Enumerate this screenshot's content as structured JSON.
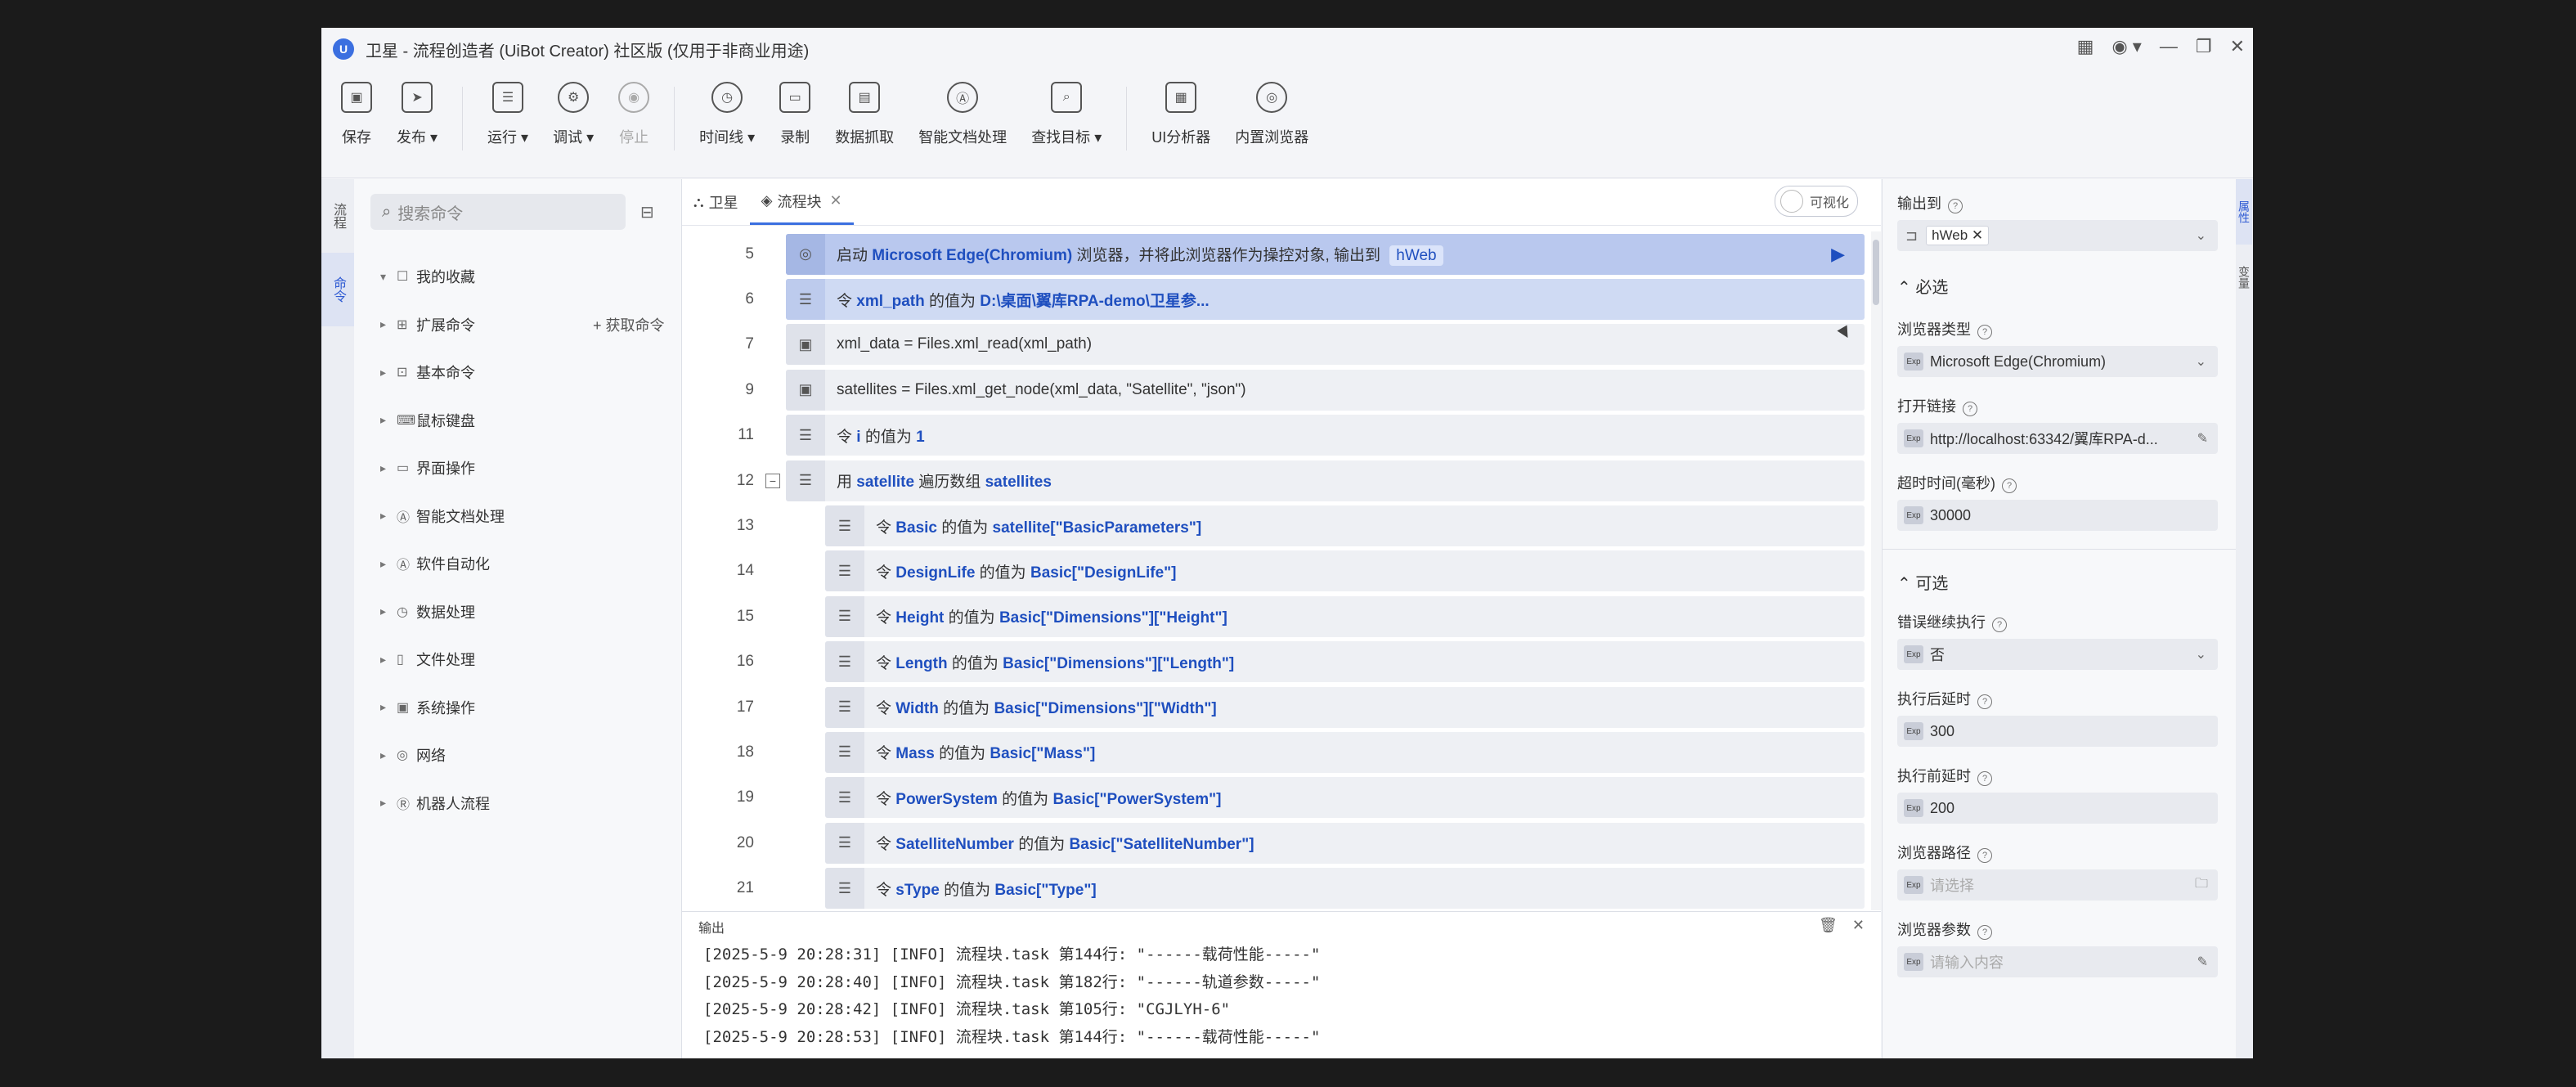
{
  "window": {
    "title": "卫星 - 流程创造者 (UiBot Creator) 社区版 (仅用于非商业用途)"
  },
  "toolbar": {
    "items": [
      {
        "label": "保存",
        "icon": "save-icon"
      },
      {
        "label": "发布 ▾",
        "icon": "send-icon"
      },
      {
        "label": "运行 ▾",
        "icon": "run-icon"
      },
      {
        "label": "调试 ▾",
        "icon": "debug-icon"
      },
      {
        "label": "停止",
        "icon": "stop-icon"
      },
      {
        "label": "时间线 ▾",
        "icon": "clock-icon"
      },
      {
        "label": "录制",
        "icon": "record-icon"
      },
      {
        "label": "数据抓取",
        "icon": "data-scrape-icon"
      },
      {
        "label": "智能文档处理",
        "icon": "ai-doc-icon"
      },
      {
        "label": "查找目标 ▾",
        "icon": "find-target-icon"
      },
      {
        "label": "UI分析器",
        "icon": "ui-analyzer-icon"
      },
      {
        "label": "内置浏览器",
        "icon": "builtin-browser-icon"
      }
    ]
  },
  "left_rail": {
    "tabs": [
      "流程",
      "命令"
    ]
  },
  "commands": {
    "search_placeholder": "搜索命令",
    "tree": [
      {
        "label": "我的收藏"
      },
      {
        "label": "扩展命令",
        "extra": "获取命令"
      },
      {
        "label": "基本命令"
      },
      {
        "label": "鼠标键盘"
      },
      {
        "label": "界面操作"
      },
      {
        "label": "智能文档处理"
      },
      {
        "label": "软件自动化"
      },
      {
        "label": "数据处理"
      },
      {
        "label": "文件处理"
      },
      {
        "label": "系统操作"
      },
      {
        "label": "网络"
      },
      {
        "label": "机器人流程"
      }
    ]
  },
  "editor": {
    "tabs": [
      {
        "label": "卫星",
        "active": false
      },
      {
        "label": "流程块",
        "active": true
      }
    ],
    "visualize_label": "可视化",
    "lines": [
      {
        "ln": "5",
        "indent": 0,
        "hl": "strong",
        "parts": [
          [
            "启动 ",
            ""
          ],
          [
            "Microsoft Edge(Chromium)",
            "kw"
          ],
          [
            " 浏览器，并将此浏览器作为操控对象, 输出到 ",
            ""
          ],
          [
            "hWeb",
            "tag"
          ]
        ],
        "play": true
      },
      {
        "ln": "6",
        "indent": 0,
        "hl": "light",
        "parts": [
          [
            "令 ",
            ""
          ],
          [
            "xml_path",
            "kw"
          ],
          [
            " 的值为 ",
            ""
          ],
          [
            "D:\\桌面\\翼库RPA-demo\\卫星参...",
            "kw"
          ]
        ]
      },
      {
        "ln": "7",
        "indent": 0,
        "parts": [
          [
            "xml_data = Files.xml_read(xml_path)",
            ""
          ]
        ]
      },
      {
        "ln": "9",
        "indent": 0,
        "parts": [
          [
            "satellites = Files.xml_get_node(xml_data, \"Satellite\", \"json\")",
            ""
          ]
        ]
      },
      {
        "ln": "11",
        "indent": 0,
        "parts": [
          [
            "令 ",
            ""
          ],
          [
            "i",
            "kw"
          ],
          [
            " 的值为 ",
            ""
          ],
          [
            "1",
            "kw"
          ]
        ]
      },
      {
        "ln": "12",
        "indent": 0,
        "fold": true,
        "parts": [
          [
            "用 ",
            ""
          ],
          [
            "satellite",
            "kw"
          ],
          [
            " 遍历数组 ",
            ""
          ],
          [
            "satellites",
            "kw"
          ]
        ]
      },
      {
        "ln": "13",
        "indent": 1,
        "parts": [
          [
            "令 ",
            ""
          ],
          [
            "Basic",
            "kw"
          ],
          [
            " 的值为 ",
            ""
          ],
          [
            "satellite[\"BasicParameters\"]",
            "kw"
          ]
        ]
      },
      {
        "ln": "14",
        "indent": 1,
        "parts": [
          [
            "令 ",
            ""
          ],
          [
            "DesignLife",
            "kw"
          ],
          [
            " 的值为 ",
            ""
          ],
          [
            "Basic[\"DesignLife\"]",
            "kw"
          ]
        ]
      },
      {
        "ln": "15",
        "indent": 1,
        "parts": [
          [
            "令 ",
            ""
          ],
          [
            "Height",
            "kw"
          ],
          [
            " 的值为 ",
            ""
          ],
          [
            "Basic[\"Dimensions\"][\"Height\"]",
            "kw"
          ]
        ]
      },
      {
        "ln": "16",
        "indent": 1,
        "parts": [
          [
            "令 ",
            ""
          ],
          [
            "Length",
            "kw"
          ],
          [
            " 的值为 ",
            ""
          ],
          [
            "Basic[\"Dimensions\"][\"Length\"]",
            "kw"
          ]
        ]
      },
      {
        "ln": "17",
        "indent": 1,
        "parts": [
          [
            "令 ",
            ""
          ],
          [
            "Width",
            "kw"
          ],
          [
            " 的值为 ",
            ""
          ],
          [
            "Basic[\"Dimensions\"][\"Width\"]",
            "kw"
          ]
        ]
      },
      {
        "ln": "18",
        "indent": 1,
        "parts": [
          [
            "令 ",
            ""
          ],
          [
            "Mass",
            "kw"
          ],
          [
            " 的值为 ",
            ""
          ],
          [
            "Basic[\"Mass\"]",
            "kw"
          ]
        ]
      },
      {
        "ln": "19",
        "indent": 1,
        "parts": [
          [
            "令 ",
            ""
          ],
          [
            "PowerSystem",
            "kw"
          ],
          [
            " 的值为 ",
            ""
          ],
          [
            "Basic[\"PowerSystem\"]",
            "kw"
          ]
        ]
      },
      {
        "ln": "20",
        "indent": 1,
        "parts": [
          [
            "令 ",
            ""
          ],
          [
            "SatelliteNumber",
            "kw"
          ],
          [
            " 的值为 ",
            ""
          ],
          [
            "Basic[\"SatelliteNumber\"]",
            "kw"
          ]
        ]
      },
      {
        "ln": "21",
        "indent": 1,
        "parts": [
          [
            "令 ",
            ""
          ],
          [
            "sType",
            "kw"
          ],
          [
            " 的值为 ",
            ""
          ],
          [
            "Basic[\"Type\"]",
            "kw"
          ]
        ]
      }
    ]
  },
  "output": {
    "title": "输出",
    "logs": [
      "[2025-5-9 20:28:31] [INFO] 流程块.task 第144行: \"------载荷性能-----\"",
      "[2025-5-9 20:28:40] [INFO] 流程块.task 第182行: \"------轨道参数-----\"",
      "[2025-5-9 20:28:42] [INFO] 流程块.task 第105行: \"CGJLYH-6\"",
      "[2025-5-9 20:28:53] [INFO] 流程块.task 第144行: \"------载荷性能-----\""
    ]
  },
  "properties": {
    "output_to_label": "输出到",
    "output_to_value": "hWeb",
    "required_title": "必选",
    "browser_type_label": "浏览器类型",
    "browser_type_value": "Microsoft Edge(Chromium)",
    "open_url_label": "打开链接",
    "open_url_value": "http://localhost:63342/翼库RPA-d...",
    "timeout_label": "超时时间(毫秒)",
    "timeout_value": "30000",
    "optional_title": "可选",
    "continue_on_error_label": "错误继续执行",
    "continue_on_error_value": "否",
    "delay_after_label": "执行后延时",
    "delay_after_value": "300",
    "delay_before_label": "执行前延时",
    "delay_before_value": "200",
    "browser_path_label": "浏览器路径",
    "browser_path_placeholder": "请选择",
    "browser_args_label": "浏览器参数",
    "browser_args_placeholder": "请输入内容",
    "exp_badge": "Exp"
  },
  "right_rail": {
    "tabs": [
      "属性",
      "变量"
    ]
  }
}
